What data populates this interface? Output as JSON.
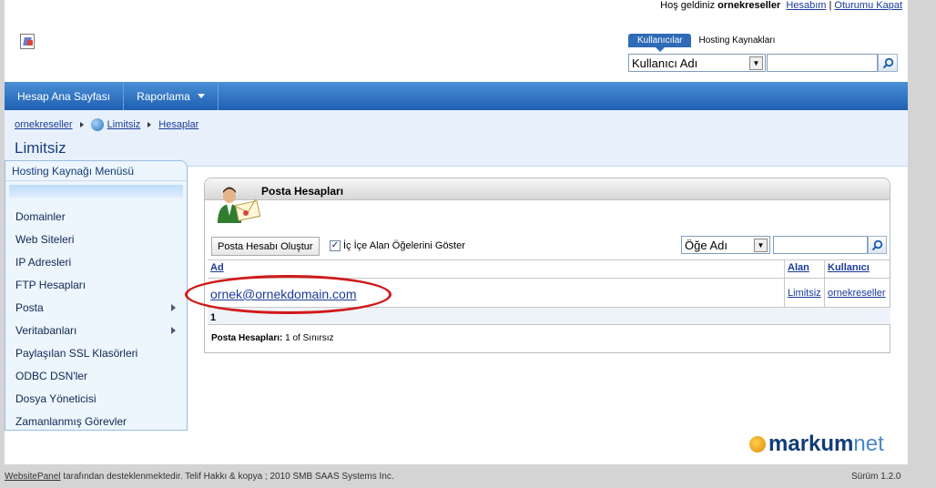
{
  "header": {
    "welcome_prefix": "Hoş geldiniz",
    "username": "ornekreseller",
    "account_link": "Hesabım",
    "separator": "|",
    "logout_link": "Oturumu Kapat"
  },
  "search": {
    "tabs": [
      {
        "label": "Kullanıcılar",
        "active": true
      },
      {
        "label": "Hosting Kaynakları",
        "active": false
      }
    ],
    "field_select": "Kullanıcı Adı",
    "query": ""
  },
  "nav": {
    "items": [
      {
        "label": "Hesap Ana Sayfası",
        "has_dropdown": false
      },
      {
        "label": "Raporlama",
        "has_dropdown": true
      }
    ]
  },
  "breadcrumb": {
    "items": [
      "ornekreseller",
      "Limitsiz",
      "Hesaplar"
    ]
  },
  "page": {
    "title": "Limitsiz"
  },
  "side_menu": {
    "title": "Hosting Kaynağı Menüsü",
    "items": [
      {
        "label": "Domainler",
        "submenu": false
      },
      {
        "label": "Web Siteleri",
        "submenu": false
      },
      {
        "label": "IP Adresleri",
        "submenu": false
      },
      {
        "label": "FTP Hesapları",
        "submenu": false
      },
      {
        "label": "Posta",
        "submenu": true
      },
      {
        "label": "Veritabanları",
        "submenu": true
      },
      {
        "label": "Paylaşılan SSL Klasörleri",
        "submenu": false
      },
      {
        "label": "ODBC DSN'ler",
        "submenu": false
      },
      {
        "label": "Dosya Yöneticisi",
        "submenu": false
      },
      {
        "label": "Zamanlanmış Görevler",
        "submenu": false
      }
    ]
  },
  "panel": {
    "title": "Posta Hesapları",
    "create_button": "Posta Hesabı Oluştur",
    "nested_checkbox_label": "İç İçe Alan Öğelerini Göster",
    "nested_checked": true,
    "filter_select": "Öğe Adı",
    "filter_query": "",
    "columns": [
      "Ad",
      "Alan",
      "Kullanıcı"
    ],
    "rows": [
      {
        "name": "ornek@ornekdomain.com",
        "space": "Limitsiz",
        "user": "ornekreseller"
      }
    ],
    "page_number": "1",
    "footer_label": "Posta Hesapları:",
    "footer_value": "1 of Sınırsız",
    "highlight_color": "#d11a1a"
  },
  "brand": {
    "name_main": "markum",
    "name_suffix": "net"
  },
  "footer": {
    "powered_link": "WebsitePanel",
    "powered_text": "tarafından desteklenmektedir. Telif Hakkı & kopya ; 2010 SMB SAAS Systems Inc.",
    "version": "Sürüm 1.2.0"
  },
  "colors": {
    "nav_blue": "#1f5fb2",
    "accent_tab": "#2f6bb7",
    "link": "#1a3a9a"
  }
}
